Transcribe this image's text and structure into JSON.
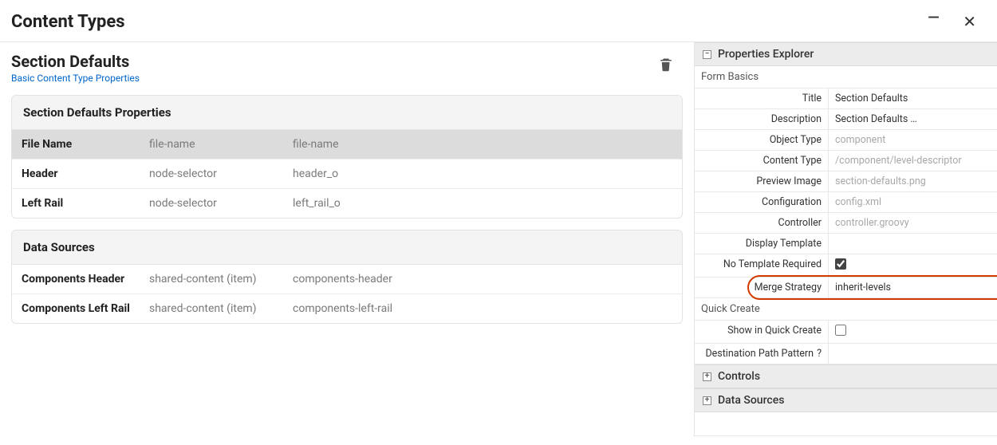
{
  "header": {
    "title": "Content Types"
  },
  "section": {
    "title": "Section Defaults",
    "link": "Basic Content Type Properties"
  },
  "propsPanel": {
    "heading": "Section Defaults Properties",
    "rows": [
      {
        "name": "File Name",
        "type": "file-name",
        "handle": "file-name",
        "highlight": true
      },
      {
        "name": "Header",
        "type": "node-selector",
        "handle": "header_o"
      },
      {
        "name": "Left Rail",
        "type": "node-selector",
        "handle": "left_rail_o"
      }
    ]
  },
  "dsPanel": {
    "heading": "Data Sources",
    "rows": [
      {
        "name": "Components Header",
        "type": "shared-content (item)",
        "handle": "components-header"
      },
      {
        "name": "Components Left Rail",
        "type": "shared-content (item)",
        "handle": "components-left-rail"
      }
    ]
  },
  "explorer": {
    "title": "Properties Explorer",
    "basics": {
      "heading": "Form Basics",
      "rows": {
        "title_label": "Title",
        "title_val": "Section Defaults",
        "desc_label": "Description",
        "desc_val": "Section Defaults …",
        "objtype_label": "Object Type",
        "objtype_val": "component",
        "ctype_label": "Content Type",
        "ctype_val": "/component/level-descriptor",
        "preview_label": "Preview Image",
        "preview_val": "section-defaults.png",
        "config_label": "Configuration",
        "config_val": "config.xml",
        "controller_label": "Controller",
        "controller_val": "controller.groovy",
        "displaytpl_label": "Display Template",
        "displaytpl_val": "",
        "notpl_label": "No Template Required",
        "merge_label": "Merge Strategy",
        "merge_val": "inherit-levels"
      }
    },
    "quickcreate": {
      "heading": "Quick Create",
      "show_label": "Show in Quick Create",
      "destpath_label": "Destination Path Pattern"
    },
    "controls_title": "Controls",
    "datasources_title": "Data Sources"
  }
}
